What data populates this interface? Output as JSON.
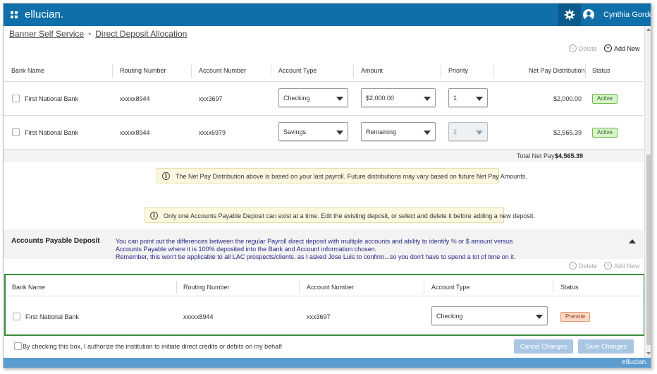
{
  "header": {
    "brand": "ellucian.",
    "user_name": "Cynthia Gordon",
    "colors": {
      "topbar": "#0f6fa8",
      "bottombar": "#5b9ccf"
    }
  },
  "breadcrumb": {
    "home": "Banner Self Service",
    "separator": "•",
    "current": "Direct Deposit Allocation"
  },
  "payroll": {
    "delete_label": "Delete",
    "add_new_label": "Add New",
    "columns": [
      "Bank Name",
      "Routing Number",
      "Account Number",
      "Account Type",
      "Amount",
      "Priority",
      "Net Pay Distribution",
      "Status"
    ],
    "rows": [
      {
        "bank": "First National Bank",
        "routing": "xxxxx8944",
        "account": "xxx3697",
        "type": "Checking",
        "amount": "$2,000.00",
        "priority": "1",
        "net_pay": "$2,000.00",
        "status": "Active"
      },
      {
        "bank": "First National Bank",
        "routing": "xxxxx8944",
        "account": "xxxx6979",
        "type": "Savings",
        "amount": "Remaining",
        "priority": "2",
        "net_pay": "$2,565.39",
        "status": "Active"
      }
    ],
    "total_label": "Total Net Pay",
    "total_value": "$4,565.39",
    "notice": "The Net Pay Distribution above is based on your last payroll. Future distributions may vary based on future Net Pay Amounts."
  },
  "ap_notice": "Only one Accounts Payable Deposit can exist at a time. Edit the existing deposit, or select and delete it before adding a new deposit.",
  "accounts_payable": {
    "title": "Accounts Payable Deposit",
    "note_lines": [
      "You can point out the differences between the regular Payroll direct deposit with multiple accounts and ability to identify % or $ amount versus",
      "Accounts Payable where it is 100% deposited into the Bank and Account information chosen.",
      "Remember, this won't be applicable to all LAC prospects/clients, as I asked Jose Luis to confirm...so you don't have to spend a lot of time on it."
    ],
    "delete_label": "Delete",
    "add_new_label": "Add New",
    "columns": [
      "Bank Name",
      "Routing Number",
      "Account Number",
      "Account Type",
      "Status"
    ],
    "row": {
      "bank": "First National Bank",
      "routing": "xxxxx8944",
      "account": "xxx3697",
      "type": "Checking",
      "status": "Prenote"
    }
  },
  "footer": {
    "authorize_label": "By checking this box, I authorize the institution to initiate direct credits or debits on my behalf",
    "cancel_label": "Cancel Changes",
    "save_label": "Save Changes",
    "brand": "ellucian."
  }
}
